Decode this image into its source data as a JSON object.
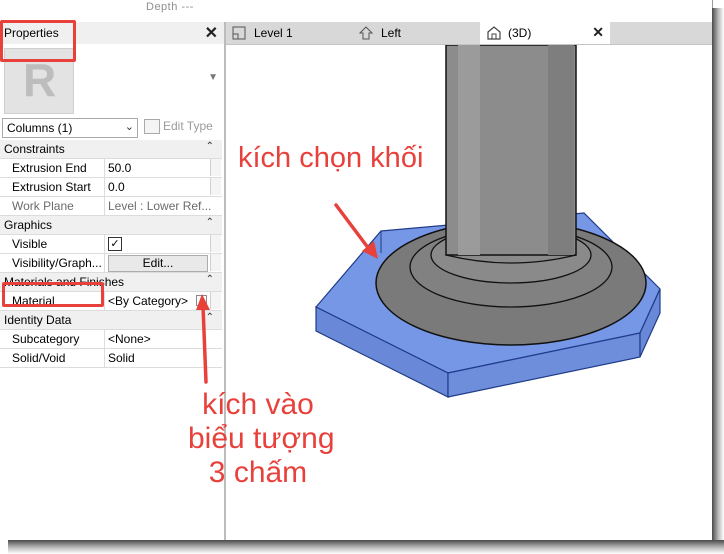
{
  "topbar": {
    "depth_label": "Depth ---"
  },
  "properties": {
    "title": "Properties",
    "logo_letter": "R",
    "selector_value": "Columns (1)",
    "edit_type_label": "Edit Type",
    "sections": {
      "constraints": "Constraints",
      "graphics": "Graphics",
      "materials": "Materials and Finishes",
      "identity": "Identity Data"
    },
    "rows": {
      "extrusion_end": {
        "key": "Extrusion End",
        "value": "50.0"
      },
      "extrusion_start": {
        "key": "Extrusion Start",
        "value": "0.0"
      },
      "work_plane": {
        "key": "Work Plane",
        "value": "Level : Lower Ref..."
      },
      "visible": {
        "key": "Visible",
        "checkmark": "✓"
      },
      "visibility": {
        "key": "Visibility/Graph...",
        "button": "Edit..."
      },
      "material": {
        "key": "Material",
        "value": "<By Category>"
      },
      "subcategory": {
        "key": "Subcategory",
        "value": "<None>"
      },
      "solid_void": {
        "key": "Solid/Void",
        "value": "Solid"
      }
    }
  },
  "tabs": [
    {
      "label": "Level 1",
      "icon": "floor-plan-icon"
    },
    {
      "label": "Left",
      "icon": "elevation-icon"
    },
    {
      "label": "(3D)",
      "icon": "3d-house-icon",
      "active": true
    }
  ],
  "annotations": {
    "select_block": "kích chọn khối",
    "click_icon_lines": [
      "kích vào",
      "biểu tượng",
      "3 chấm"
    ]
  },
  "colors": {
    "annotation_red": "#e8413c",
    "selection_blue": "#6e8fe0",
    "column_gray": "#8a8a8a"
  }
}
